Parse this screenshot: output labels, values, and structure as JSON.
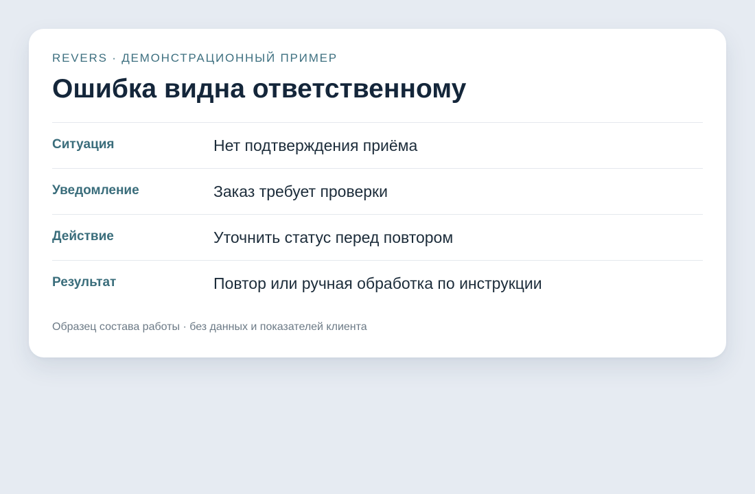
{
  "card": {
    "eyebrow": "REVERS · ДЕМОНСТРАЦИОННЫЙ ПРИМЕР",
    "title": "Ошибка видна ответственному",
    "rows": [
      {
        "label": "Ситуация",
        "value": "Нет подтверждения приёма"
      },
      {
        "label": "Уведомление",
        "value": "Заказ требует проверки"
      },
      {
        "label": "Действие",
        "value": "Уточнить статус перед повтором"
      },
      {
        "label": "Результат",
        "value": "Повтор или ручная обработка по инструкции"
      }
    ],
    "footnote": "Образец состава работы · без данных и показателей клиента"
  },
  "colors": {
    "background": "#e6ebf2",
    "card": "#ffffff",
    "accent": "#3a6d7b",
    "title": "#14263a",
    "text": "#1c2c3a",
    "muted": "#6c7a86"
  }
}
